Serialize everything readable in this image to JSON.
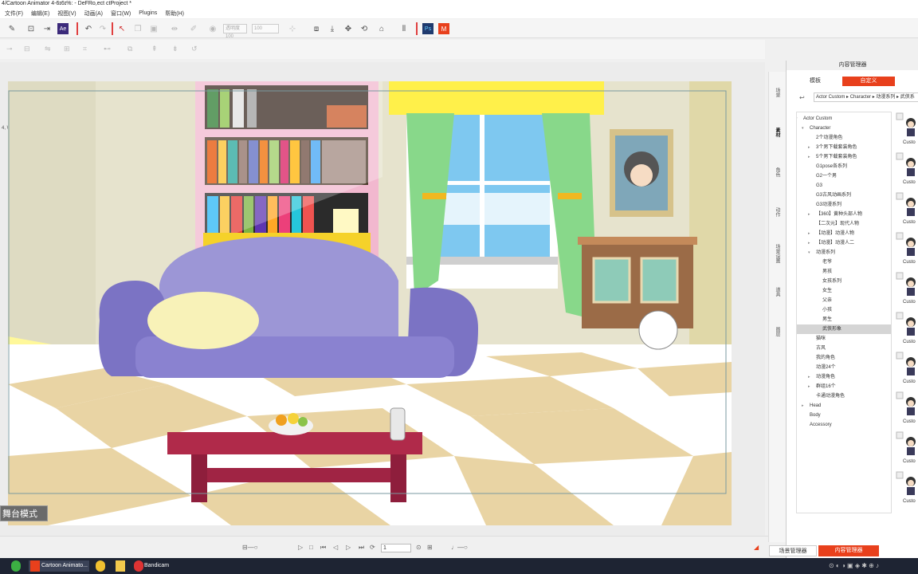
{
  "window": {
    "title": "4/Cartoon Animator 4-6ɪ6ɪ%: - DeFRo,ect ctProject *"
  },
  "menu": [
    "文件(F)",
    "编辑(E)",
    "视图(V)",
    "动画(A)",
    "窗口(W)",
    "Plugins",
    "帮助(H)"
  ],
  "toolbar": {
    "opacity_field": "透明度 100",
    "zoom_field": "100"
  },
  "canvas": {
    "coords": "4,  W6: 6D.27",
    "mode_label": "舞台模式"
  },
  "timeline": {
    "frame": "1"
  },
  "side_tabs": [
    "场景",
    "素材",
    "角色",
    "动作",
    "场景设置",
    "道具",
    "图层"
  ],
  "content_manager": {
    "title": "内容管理器",
    "tabs": [
      "模板",
      "自定义"
    ],
    "active_tab": "自定义",
    "breadcrumb": "Actor Custom ▸ Character ▸ 动漫系列 ▸ 武侠系",
    "tree": [
      {
        "label": "Actor Custom",
        "level": 0,
        "arrow": "▾"
      },
      {
        "label": "Character",
        "level": 1,
        "arrow": "▾"
      },
      {
        "label": "2个动漫角色",
        "level": 2,
        "arrow": ""
      },
      {
        "label": "3个男下载套装角色",
        "level": 2,
        "arrow": "▸"
      },
      {
        "label": "5个男下载套装角色",
        "level": 2,
        "arrow": "▸"
      },
      {
        "label": "G1pose各系列",
        "level": 2,
        "arrow": ""
      },
      {
        "label": "G2一个男",
        "level": 2,
        "arrow": ""
      },
      {
        "label": "G3",
        "level": 2,
        "arrow": ""
      },
      {
        "label": "G3古风动画系列",
        "level": 2,
        "arrow": ""
      },
      {
        "label": "G3动漫系列",
        "level": 2,
        "arrow": ""
      },
      {
        "label": "【360】黄种头部人物",
        "level": 2,
        "arrow": "▸"
      },
      {
        "label": "【二次元】现代人物",
        "level": 2,
        "arrow": ""
      },
      {
        "label": "【动漫】动漫人物",
        "level": 2,
        "arrow": "▸"
      },
      {
        "label": "【动漫】动漫人二",
        "level": 2,
        "arrow": "▸"
      },
      {
        "label": "动漫系列",
        "level": 2,
        "arrow": "▾"
      },
      {
        "label": "老爷",
        "level": 3,
        "arrow": ""
      },
      {
        "label": "男孩",
        "level": 3,
        "arrow": ""
      },
      {
        "label": "女孩系列",
        "level": 3,
        "arrow": ""
      },
      {
        "label": "女生",
        "level": 3,
        "arrow": ""
      },
      {
        "label": "父亲",
        "level": 3,
        "arrow": ""
      },
      {
        "label": "小孩",
        "level": 3,
        "arrow": ""
      },
      {
        "label": "男生",
        "level": 3,
        "arrow": ""
      },
      {
        "label": "武侠形象",
        "level": 3,
        "arrow": "",
        "selected": true
      },
      {
        "label": "猫咪",
        "level": 2,
        "arrow": ""
      },
      {
        "label": "古风",
        "level": 2,
        "arrow": ""
      },
      {
        "label": "我的角色",
        "level": 2,
        "arrow": ""
      },
      {
        "label": "动漫24个",
        "level": 2,
        "arrow": ""
      },
      {
        "label": "动漫角色",
        "level": 2,
        "arrow": "▸"
      },
      {
        "label": "群组16个",
        "level": 2,
        "arrow": "▸"
      },
      {
        "label": "卡通动漫角色",
        "level": 2,
        "arrow": ""
      },
      {
        "label": "Head",
        "level": 1,
        "arrow": "▸"
      },
      {
        "label": "Body",
        "level": 1,
        "arrow": ""
      },
      {
        "label": "Accessory",
        "level": 1,
        "arrow": ""
      }
    ],
    "thumb_label": "Custo",
    "bottom_tabs": [
      "场景管理器",
      "内容管理器"
    ]
  },
  "taskbar": {
    "items": [
      "Cartoon Animato...",
      "Bandicam"
    ]
  },
  "colors": {
    "accent": "#e8401c",
    "taskbar": "#1e2433"
  }
}
